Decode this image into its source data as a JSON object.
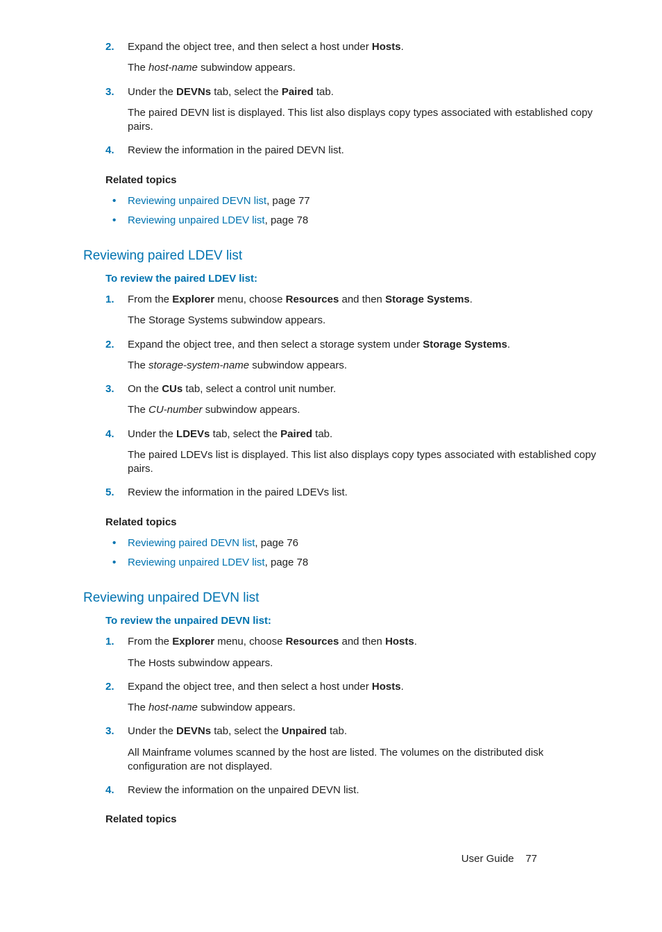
{
  "section1": {
    "steps": [
      {
        "num": "2.",
        "text_html": "Expand the object tree, and then select a host under <b>Hosts</b>.",
        "after_html": "The <i>host-name</i> subwindow appears."
      },
      {
        "num": "3.",
        "text_html": "Under the <b>DEVNs</b> tab, select the <b>Paired</b> tab.",
        "after_html": "The paired DEVN list is displayed. This list also displays copy types associated with established copy pairs."
      },
      {
        "num": "4.",
        "text_html": "Review the information in the paired DEVN list.",
        "after_html": ""
      }
    ],
    "related_heading": "Related topics",
    "related": [
      {
        "link": "Reviewing unpaired DEVN list",
        "suffix": ", page 77"
      },
      {
        "link": "Reviewing unpaired LDEV list",
        "suffix": ", page 78"
      }
    ]
  },
  "section2": {
    "heading": "Reviewing paired LDEV list",
    "subheading": "To review the paired LDEV list:",
    "steps": [
      {
        "num": "1.",
        "text_html": "From the <b>Explorer</b> menu, choose <b>Resources</b> and then <b>Storage Systems</b>.",
        "after_html": "The Storage Systems subwindow appears."
      },
      {
        "num": "2.",
        "text_html": "Expand the object tree, and then select a storage system under <b>Storage Systems</b>.",
        "after_html": "The <i>storage-system-name</i> subwindow appears."
      },
      {
        "num": "3.",
        "text_html": "On the <b>CUs</b> tab, select a control unit number.",
        "after_html": "The <i>CU-number</i> subwindow appears."
      },
      {
        "num": "4.",
        "text_html": "Under the <b>LDEVs</b> tab, select the <b>Paired</b> tab.",
        "after_html": "The paired LDEVs list is displayed. This list also displays copy types associated with established copy pairs."
      },
      {
        "num": "5.",
        "text_html": "Review the information in the paired LDEVs list.",
        "after_html": ""
      }
    ],
    "related_heading": "Related topics",
    "related": [
      {
        "link": "Reviewing paired DEVN list",
        "suffix": ", page 76"
      },
      {
        "link": "Reviewing unpaired LDEV list",
        "suffix": ", page 78"
      }
    ]
  },
  "section3": {
    "heading": "Reviewing unpaired DEVN list",
    "subheading": "To review the unpaired DEVN list:",
    "steps": [
      {
        "num": "1.",
        "text_html": "From the <b>Explorer</b> menu, choose <b>Resources</b> and then <b>Hosts</b>.",
        "after_html": "The Hosts subwindow appears."
      },
      {
        "num": "2.",
        "text_html": "Expand the object tree, and then select a host under <b>Hosts</b>.",
        "after_html": "The <i>host-name</i> subwindow appears."
      },
      {
        "num": "3.",
        "text_html": "Under the <b>DEVNs</b> tab, select the <b>Unpaired</b> tab.",
        "after_html": "All Mainframe volumes scanned by the host are listed. The volumes on the distributed disk configuration are not displayed."
      },
      {
        "num": "4.",
        "text_html": "Review the information on the unpaired DEVN list.",
        "after_html": ""
      }
    ],
    "related_heading": "Related topics"
  },
  "footer": {
    "label": "User Guide",
    "page": "77"
  }
}
